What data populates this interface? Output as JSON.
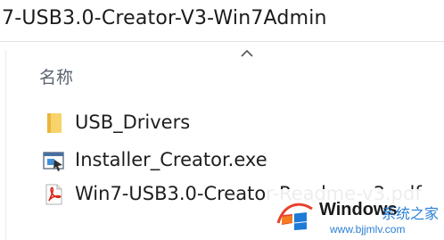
{
  "address_bar": {
    "path": "7-USB3.0-Creator-V3-Win7Admin"
  },
  "file_list": {
    "column_header": "名称",
    "sort_icon": "chevron-up-icon",
    "items": [
      {
        "name": "USB_Drivers",
        "icon": "folder-icon"
      },
      {
        "name": "Installer_Creator.exe",
        "icon": "exe-app-icon"
      },
      {
        "name": "Win7-USB3.0-Creator-Readme-v3.pdf",
        "icon": "pdf-icon"
      }
    ]
  },
  "watermark": {
    "title": "Windows",
    "subtitle": "系统之家",
    "url": "www.bjjmlv.com",
    "colors": {
      "logo_red": "#e8412c",
      "logo_blue": "#1e7ad6",
      "text_blue": "#2a7fd4"
    }
  }
}
